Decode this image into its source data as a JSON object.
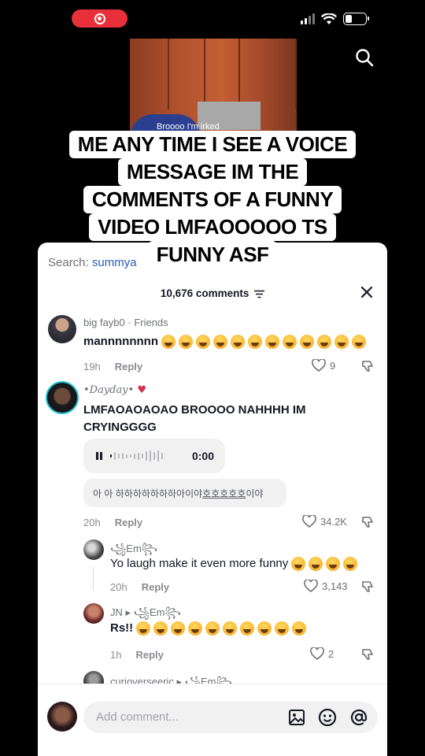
{
  "status_bar": {
    "battery_level": 0.35
  },
  "video": {
    "caption": "Broooo I'm irked"
  },
  "meme_caption": [
    "ME ANY TIME I SEE A VOICE",
    "MESSAGE IM THE",
    "COMMENTS OF A FUNNY",
    "VIDEO LMFAOOOOO TS",
    "FUNNY ASF"
  ],
  "comments_panel": {
    "search_label": "Search:",
    "search_term": "summya",
    "count_label": "10,676 comments",
    "comments": [
      {
        "username": "big fayb0 · Friends",
        "text": "mannnnnnnn",
        "emoji_count": 12,
        "time": "19h",
        "reply_label": "Reply",
        "likes": "9"
      },
      {
        "username": "•Dayday•",
        "text_line1": "LMFAOAOAOAO BROOOO NAHHHH IM",
        "text_line2": "CRYINGGGG",
        "audio_time": "0:00",
        "transcript_prefix": "아 아 하하하하하하하아이야 ",
        "transcript_underlined": "호호호호호",
        "transcript_suffix": "이야",
        "time": "20h",
        "reply_label": "Reply",
        "likes": "34.2K"
      },
      {
        "username": "꧁Em꧂",
        "text": "Yo laugh make it even more funny",
        "emoji_count": 4,
        "time": "20h",
        "reply_label": "Reply",
        "likes": "3,143"
      },
      {
        "username": "JN ▸ ꧁Em꧂",
        "text": "Rs!!",
        "emoji_count": 10,
        "time": "1h",
        "reply_label": "Reply",
        "likes": "2"
      },
      {
        "username": "curioverseeric ▸ ꧁Em꧂"
      }
    ],
    "input_placeholder": "Add comment..."
  },
  "colors": {
    "record_red": "#e8303a",
    "link_blue": "#2b5db8",
    "sheet_bg": "#ffffff"
  }
}
